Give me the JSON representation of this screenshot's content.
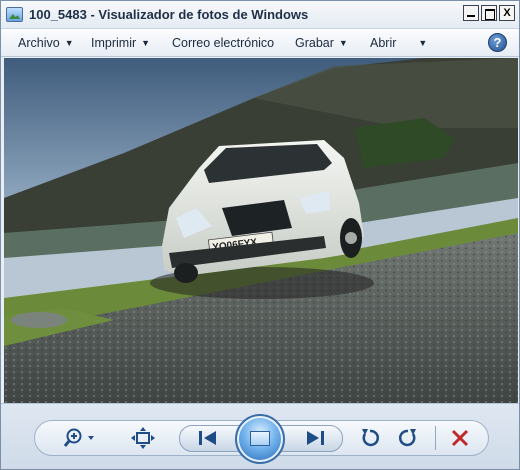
{
  "window": {
    "title": "100_5483 - Visualizador de fotos de Windows",
    "controls": {
      "close_glyph": "X"
    }
  },
  "menu": {
    "items": [
      {
        "label": "Archivo",
        "has_dropdown": true
      },
      {
        "label": "Imprimir",
        "has_dropdown": true
      },
      {
        "label": "Correo electrónico",
        "has_dropdown": false
      },
      {
        "label": "Grabar",
        "has_dropdown": true
      },
      {
        "label": "Abrir",
        "has_dropdown": true
      }
    ],
    "help_glyph": "?"
  },
  "photo": {
    "subject": "white sedan on cobblestone road by a lake with hills",
    "plate_text": "YO06FYX"
  },
  "toolbar": {
    "icons": [
      "zoom-icon",
      "actual-size-icon",
      "previous-icon",
      "slideshow-icon",
      "next-icon",
      "rotate-counterclockwise-icon",
      "rotate-clockwise-icon",
      "delete-icon"
    ]
  },
  "colors": {
    "accent": "#1e4c86",
    "delete": "#c0282a"
  }
}
